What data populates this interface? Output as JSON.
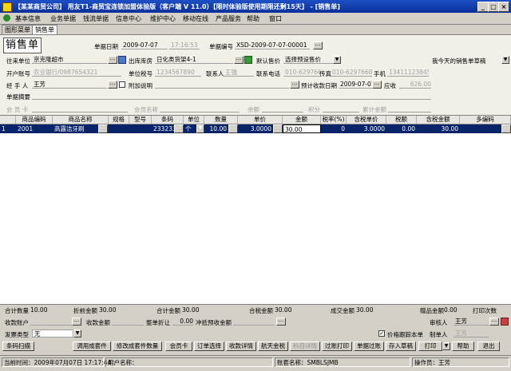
{
  "window": {
    "title": "【某某商贸公司】 用友T1-商贸宝连锁加盟体验版（客户端 V 11.0）【限时体验版使用期限还剩15天】 - [销售单]"
  },
  "menu": [
    "基本信息",
    "业务单据",
    "钱流单据",
    "信息中心",
    "维护中心",
    "移动在线",
    "产品服务",
    "帮助",
    "窗口"
  ],
  "tabs": [
    "图形菜单",
    "销售单"
  ],
  "form": {
    "stamp": "销售单",
    "date_label": "单据日期",
    "date": "2009-07-07",
    "time": "17:16:53",
    "billno_label": "单据编号",
    "billno": "XSD-2009-07-07-00001",
    "customer_label": "往来单位",
    "customer": "京克隆超市",
    "warehouse_label": "出库库房",
    "warehouse": "日化类货架4-1",
    "price_label": "默认售价",
    "price_mode": "选择预设售价",
    "draft_text": "我今天的销售单草稿",
    "account_label": "开户账号",
    "account": "农业银行/0987654321",
    "taxno_label": "单位税号",
    "taxno": "1234567890",
    "contact_label": "联系人",
    "contact": "王强",
    "phone_label": "联系电话",
    "phone": "010-62976688",
    "fax_label": "传真",
    "fax": "010-62976688",
    "mobile_label": "手机",
    "mobile": "13411123845",
    "handler_label": "经 手 人",
    "handler": "王芳",
    "attach_label": "附加说明",
    "paydate_label": "预计收款日期",
    "paydate": "2009-07-07",
    "receivable_label": "应收",
    "receivable": "626.00",
    "summary_label": "单据摘要",
    "member_label": "会 员 卡",
    "member_name_label": "会员名称",
    "balance_label": "余额",
    "points_label": "积分",
    "total_points_label": "累计金额"
  },
  "grid": {
    "headers": [
      "",
      "商品编码",
      "商品名称",
      "规格",
      "型号",
      "条码",
      "单位",
      "数量",
      "单价",
      "金额",
      "税率(%)",
      "含税单价",
      "税额",
      "含税金额",
      "多编码"
    ],
    "rows": [
      {
        "no": "1",
        "code": "2001",
        "name": "高露洁牙刷",
        "spec": "",
        "model": "",
        "barcode": "233233...",
        "unit": "个",
        "qty": "10.00",
        "price": "3.0000",
        "amount": "30.00",
        "taxrate": "0",
        "taxprice": "3.0000",
        "tax": "0.00",
        "taxamount": "30.00",
        "multi": ""
      }
    ]
  },
  "summary": {
    "qty_label": "合计数量",
    "qty": "10.00",
    "disc_label": "折前金额",
    "disc": "30.00",
    "total_label": "合计金额",
    "total": "30.00",
    "taxtotal_label": "合税金额",
    "taxtotal": "30.00",
    "deal_label": "成交金额",
    "deal": "30.00",
    "gift_label": "赠品金额",
    "gift": "0.00",
    "print_label": "打印次数"
  },
  "bottom": {
    "recv_acct_label": "收款账户",
    "recv_amt_label": "收款金额",
    "whole_disc_label": "整单折让",
    "whole_disc": "0.00",
    "offset_label": "冲抵预收金额",
    "reviewer_label": "审核人",
    "reviewer": "王芳",
    "invoice_label": "发票类型",
    "invoice": "无",
    "track_label": "价格跟踪本单",
    "maker_label": "制单人",
    "maker": "王芳"
  },
  "buttons": [
    "条码扫描",
    "调用成套件",
    "修改成套件数量",
    "会员卡",
    "订单选择",
    "收款详情",
    "航天金税",
    "科目详情",
    "过账打印",
    "单据过账",
    "存入草稿",
    "打印",
    "帮助",
    "退出"
  ],
  "status": {
    "time": "当前时间：2009年07月07日 17:17:44",
    "user": "用户名称：",
    "acct": "账套名称：SMBLSJMB",
    "operator": "操作员：王芳"
  }
}
